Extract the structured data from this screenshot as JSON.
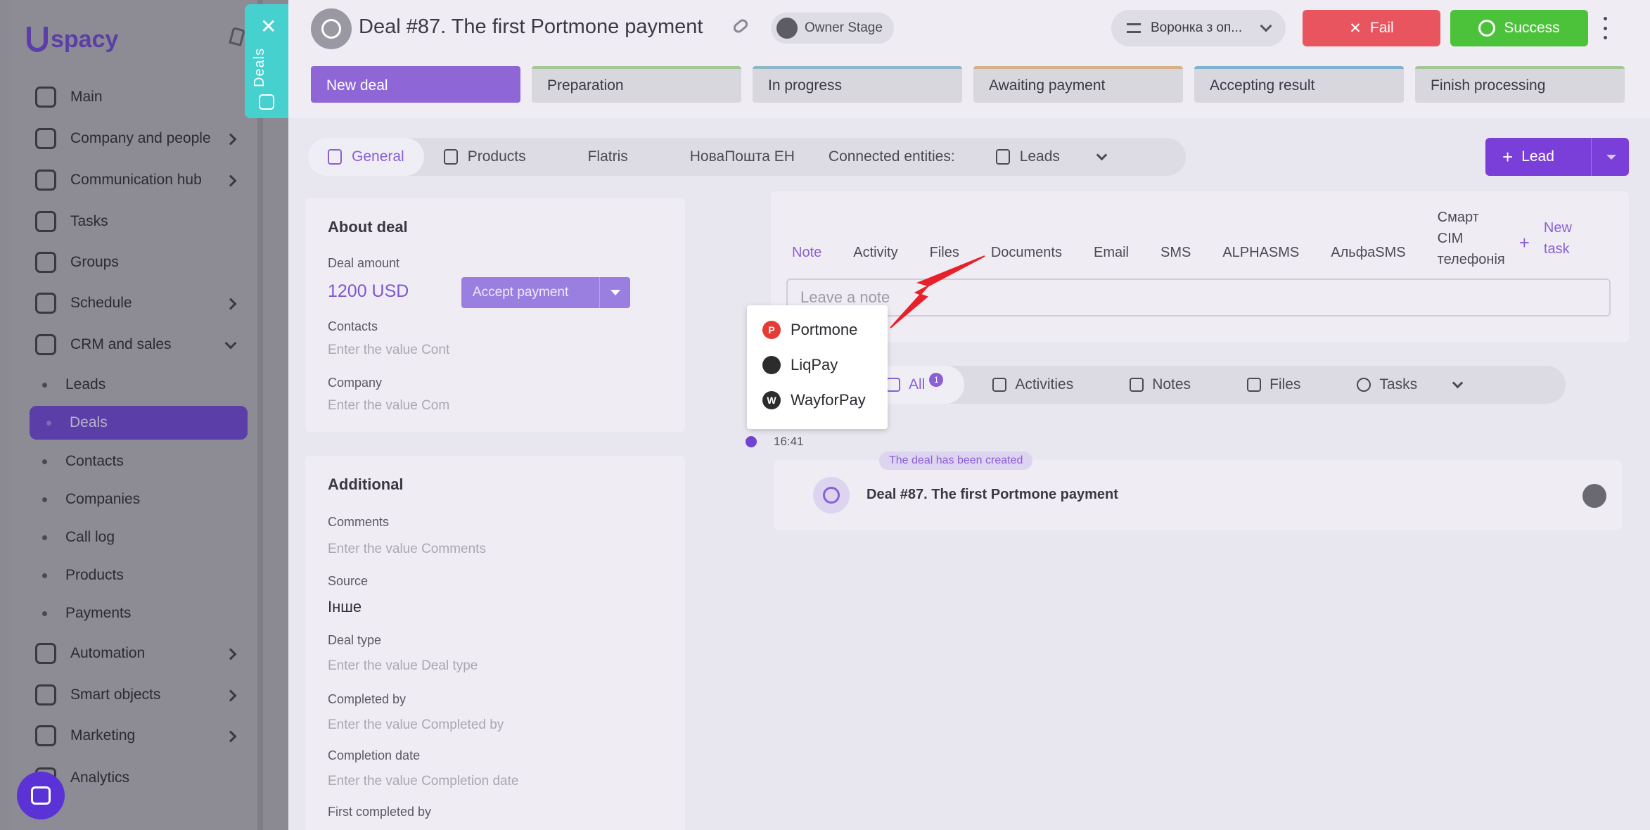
{
  "sidebar": {
    "logo": "spacy",
    "nav": [
      {
        "label": "Main",
        "icon": "home-icon"
      },
      {
        "label": "Company and people",
        "icon": "company-icon"
      },
      {
        "label": "Communication hub",
        "icon": "communication-icon"
      },
      {
        "label": "Tasks",
        "icon": "tasks-icon"
      },
      {
        "label": "Groups",
        "icon": "groups-icon"
      },
      {
        "label": "Schedule",
        "icon": "calendar-icon"
      },
      {
        "label": "CRM and sales",
        "icon": "database-icon"
      }
    ],
    "crm_sub": [
      "Leads",
      "Deals",
      "Contacts",
      "Companies",
      "Call log",
      "Products",
      "Payments"
    ],
    "nav_bottom": [
      {
        "label": "Automation",
        "icon": "lightning-icon"
      },
      {
        "label": "Smart objects",
        "icon": "smart-objects-icon"
      },
      {
        "label": "Marketing",
        "icon": "marketing-icon"
      },
      {
        "label": "Analytics",
        "icon": "analytics-icon"
      }
    ]
  },
  "deals_tab": {
    "label": "Deals"
  },
  "header": {
    "title": "Deal #87. The first Portmone payment",
    "owner_stage": "Owner Stage",
    "funnel": "Воронка з оп...",
    "fail_label": "Fail",
    "success_label": "Success"
  },
  "stages": [
    "New deal",
    "Preparation",
    "In progress",
    "Awaiting payment",
    "Accepting result",
    "Finish processing"
  ],
  "entity_tabs": {
    "general": "General",
    "products": "Products",
    "flatris": "Flatris",
    "novaposhta": "НоваПошта ЕН",
    "connected": "Connected entities:",
    "leads": "Leads"
  },
  "lead_button": "Lead",
  "about": {
    "title": "About deal",
    "amount_label": "Deal amount",
    "amount": "1200 USD",
    "accept_payment": "Accept payment",
    "contacts_label": "Contacts",
    "contacts_placeholder": "Enter the value Cont",
    "company_label": "Company",
    "company_placeholder": "Enter the value Com"
  },
  "payment_options": [
    "Portmone",
    "LiqPay",
    "WayforPay"
  ],
  "additional": {
    "title": "Additional",
    "comments_label": "Comments",
    "comments_placeholder": "Enter the value Comments",
    "source_label": "Source",
    "source_value": "Інше",
    "deal_type_label": "Deal type",
    "deal_type_placeholder": "Enter the value Deal type",
    "completed_by_label": "Completed by",
    "completed_by_placeholder": "Enter the value Completed by",
    "completion_date_label": "Completion date",
    "completion_date_placeholder": "Enter the value Completion date",
    "first_completed_label": "First completed by"
  },
  "note_tabs": {
    "note": "Note",
    "activity": "Activity",
    "files": "Files",
    "documents": "Documents",
    "email": "Email",
    "sms": "SMS",
    "alphasms": "ALPHASMS",
    "alfasms": "АльфаSMS",
    "smart1": "Смарт",
    "smart2": "СІМ",
    "smart3": "телефонія",
    "newtask1": "New",
    "newtask2": "task"
  },
  "note_placeholder": "Leave a note",
  "feed_filter": {
    "all": "All",
    "all_count": "1",
    "activities": "Activities",
    "notes": "Notes",
    "files": "Files",
    "tasks": "Tasks"
  },
  "timeline": {
    "time": "16:41",
    "event_chip": "The deal has been created",
    "event_title": "Deal #87. The first Portmone payment"
  },
  "colors": {
    "accent": "#8b5fd6",
    "fail": "#e9555f",
    "success": "#4cc23a",
    "deals_tab": "#46d1cf",
    "arrow": "#e8202a"
  }
}
